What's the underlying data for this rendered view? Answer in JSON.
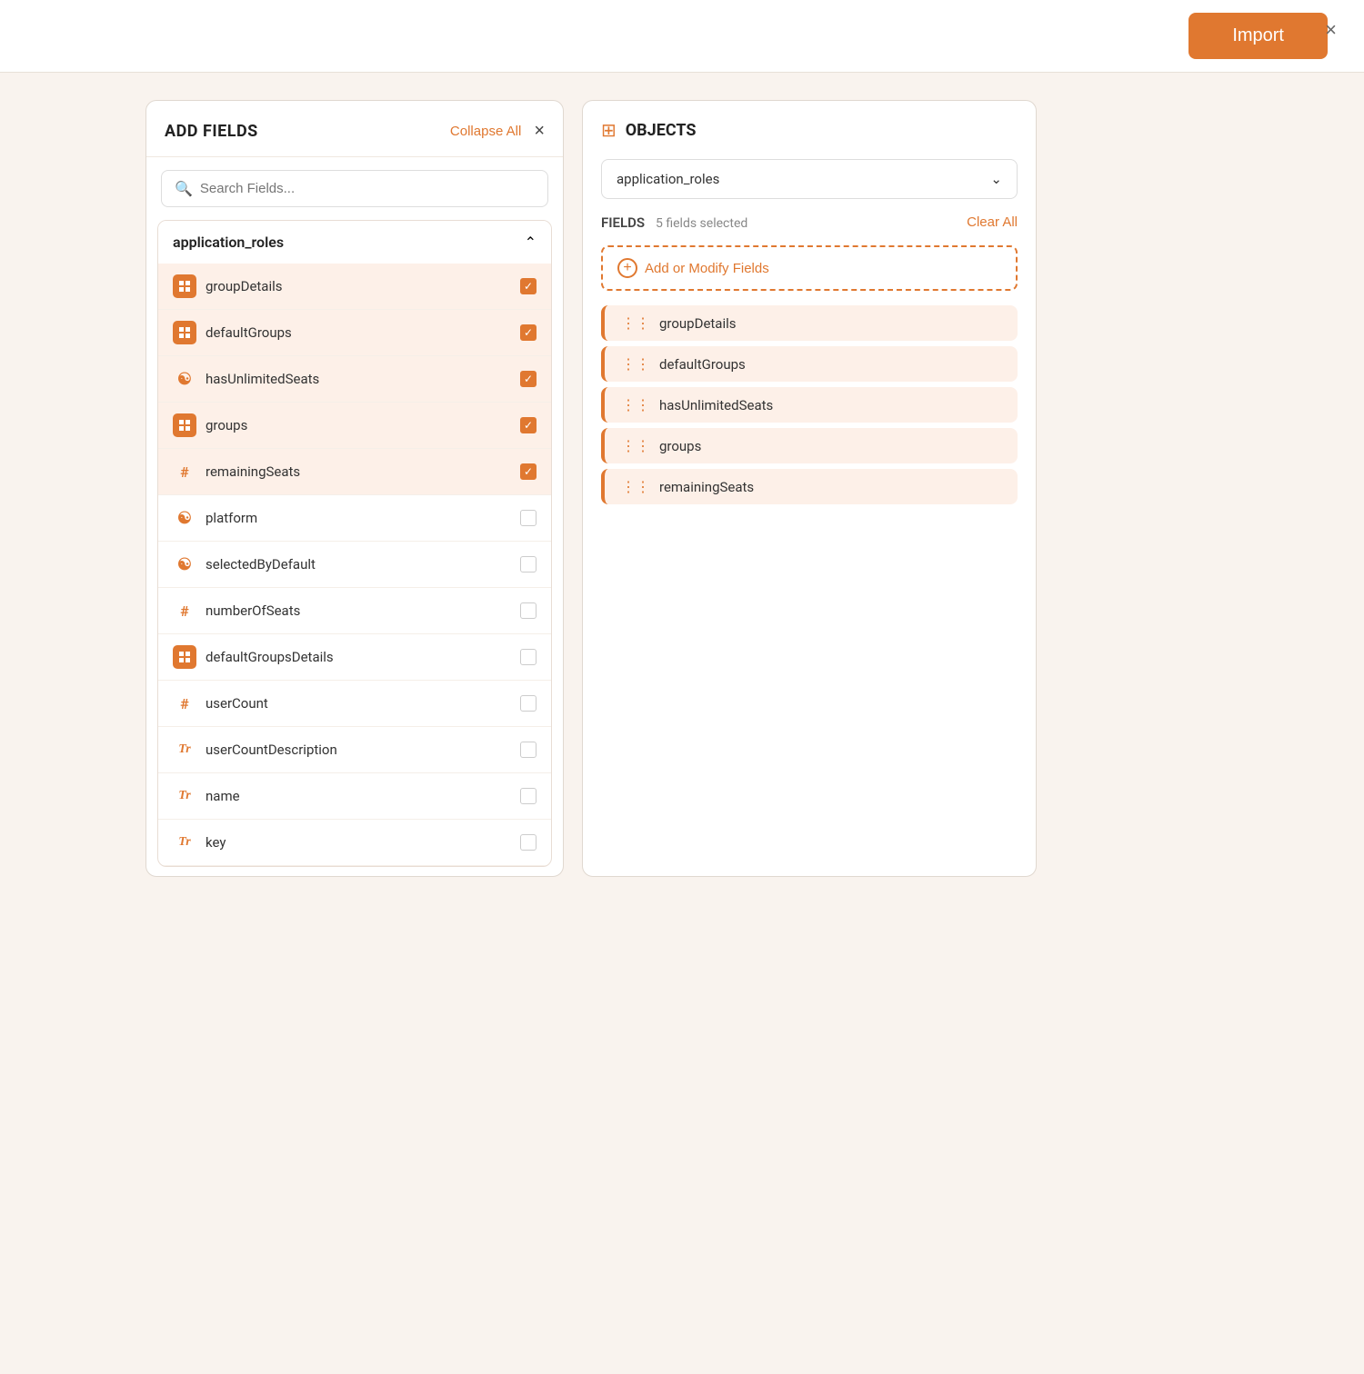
{
  "topBar": {
    "importLabel": "Import",
    "closeLabel": "×"
  },
  "leftPanel": {
    "title": "ADD FIELDS",
    "collapseAllLabel": "Collapse All",
    "searchPlaceholder": "Search Fields...",
    "groupName": "application_roles",
    "fields": [
      {
        "id": "groupDetails",
        "name": "groupDetails",
        "type": "array",
        "selected": true
      },
      {
        "id": "defaultGroups",
        "name": "defaultGroups",
        "type": "array",
        "selected": true
      },
      {
        "id": "hasUnlimitedSeats",
        "name": "hasUnlimitedSeats",
        "type": "bool",
        "selected": true
      },
      {
        "id": "groups",
        "name": "groups",
        "type": "array",
        "selected": true
      },
      {
        "id": "remainingSeats",
        "name": "remainingSeats",
        "type": "number",
        "selected": true
      },
      {
        "id": "platform",
        "name": "platform",
        "type": "bool",
        "selected": false
      },
      {
        "id": "selectedByDefault",
        "name": "selectedByDefault",
        "type": "bool",
        "selected": false
      },
      {
        "id": "numberOfSeats",
        "name": "numberOfSeats",
        "type": "number",
        "selected": false
      },
      {
        "id": "defaultGroupsDetails",
        "name": "defaultGroupsDetails",
        "type": "array",
        "selected": false
      },
      {
        "id": "userCount",
        "name": "userCount",
        "type": "number",
        "selected": false
      },
      {
        "id": "userCountDescription",
        "name": "userCountDescription",
        "type": "string",
        "selected": false
      },
      {
        "id": "name",
        "name": "name",
        "type": "string",
        "selected": false
      },
      {
        "id": "key",
        "name": "key",
        "type": "string",
        "selected": false
      }
    ]
  },
  "rightPanel": {
    "objectsTitle": "OBJECTS",
    "selectedObject": "application_roles",
    "fieldsLabel": "FIELDS",
    "fieldsCount": "5 fields selected",
    "clearAllLabel": "Clear All",
    "addModifyLabel": "Add or Modify Fields",
    "selectedFields": [
      {
        "name": "groupDetails"
      },
      {
        "name": "defaultGroups"
      },
      {
        "name": "hasUnlimitedSeats"
      },
      {
        "name": "groups"
      },
      {
        "name": "remainingSeats"
      }
    ]
  }
}
